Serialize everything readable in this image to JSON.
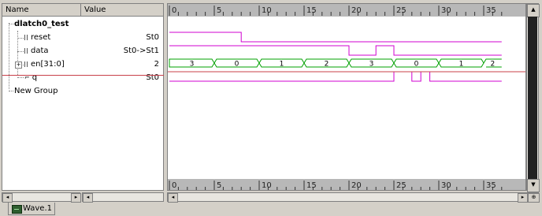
{
  "header": {
    "name_label": "Name",
    "value_label": "Value"
  },
  "tree": {
    "module": "dlatch0_test",
    "signals": [
      {
        "name": "reset",
        "value": "St0"
      },
      {
        "name": "data",
        "value": "St0->St1"
      },
      {
        "name": "en[31:0]",
        "value": "2"
      },
      {
        "name": "q",
        "value": "St0"
      }
    ],
    "group": "New Group"
  },
  "ruler": {
    "ticks": [
      "0",
      "5",
      "10",
      "15",
      "20",
      "25",
      "30",
      "35"
    ]
  },
  "waveform": {
    "time_range": [
      0,
      37
    ],
    "reset": [
      [
        0,
        1
      ],
      [
        8,
        0
      ]
    ],
    "data": [
      [
        0,
        1
      ],
      [
        20,
        0
      ],
      [
        23,
        1
      ],
      [
        25,
        0
      ]
    ],
    "en": [
      {
        "start": 0,
        "end": 5,
        "label": "3"
      },
      {
        "start": 5,
        "end": 10,
        "label": "0"
      },
      {
        "start": 10,
        "end": 15,
        "label": "1"
      },
      {
        "start": 15,
        "end": 20,
        "label": "2"
      },
      {
        "start": 20,
        "end": 25,
        "label": "3"
      },
      {
        "start": 25,
        "end": 30,
        "label": "0"
      },
      {
        "start": 30,
        "end": 35,
        "label": "1"
      },
      {
        "start": 35,
        "end": 37,
        "label": "2"
      }
    ],
    "q": [
      [
        0,
        0
      ],
      [
        25,
        1
      ],
      [
        27,
        0
      ],
      [
        28,
        1
      ],
      [
        29,
        0
      ]
    ]
  },
  "tab": {
    "label": "Wave.1"
  },
  "colors": {
    "signal": "#d000d0",
    "bus": "#00a000",
    "cursor": "#c8404a",
    "label": "#000000"
  }
}
